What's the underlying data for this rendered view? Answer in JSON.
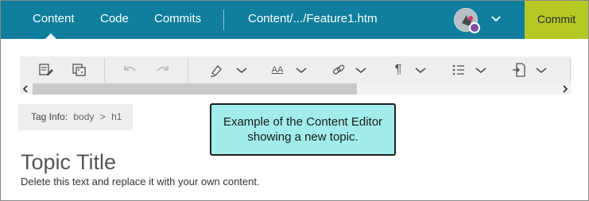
{
  "nav": {
    "tabs": [
      {
        "label": "Content",
        "active": true
      },
      {
        "label": "Code",
        "active": false
      },
      {
        "label": "Commits",
        "active": false
      }
    ],
    "file_path": "Content/.../Feature1.htm",
    "commit_label": "Commit",
    "colors": {
      "bar": "#0f7f9d",
      "commit": "#b5c823"
    }
  },
  "toolbar": {
    "icons": [
      "edit-note-icon",
      "tags-icon",
      "undo-icon",
      "redo-icon",
      "highlighter-icon",
      "font-size-icon",
      "link-icon",
      "paragraph-icon",
      "list-icon",
      "insert-file-icon"
    ],
    "font_size_glyph": "AA",
    "paragraph_glyph": "¶"
  },
  "tag_info": {
    "label": "Tag Info:",
    "path": [
      "body",
      "h1"
    ],
    "separator": ">"
  },
  "callout": {
    "line1": "Example of the Content Editor",
    "line2": "showing a new topic."
  },
  "editor": {
    "title": "Topic Title",
    "body": "Delete this text and replace it with your own content."
  }
}
